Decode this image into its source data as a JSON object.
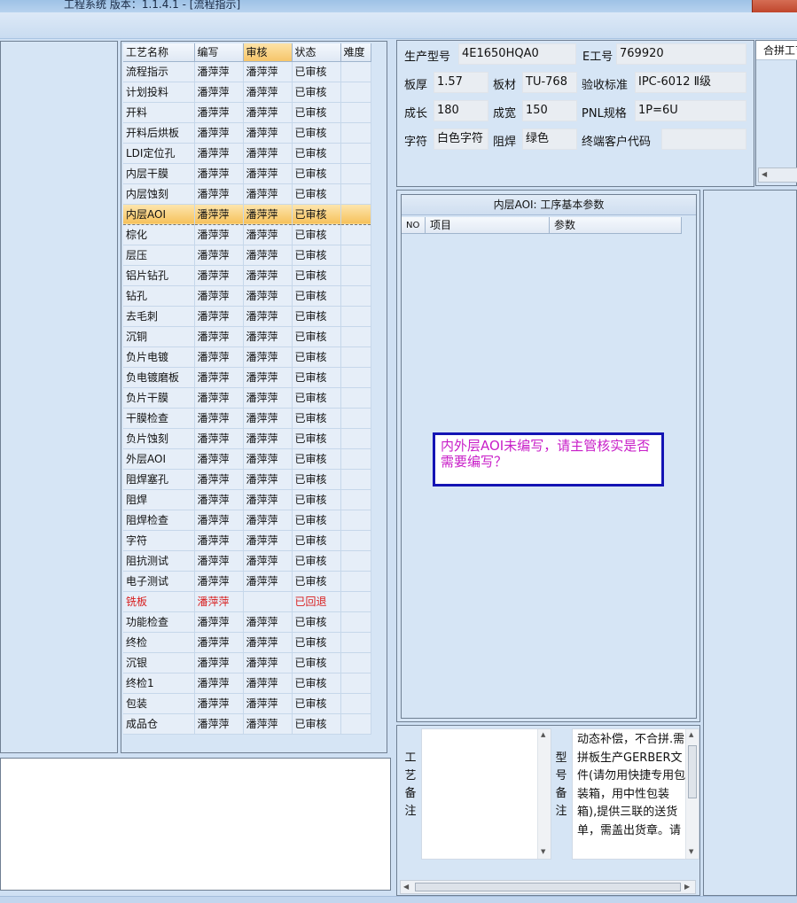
{
  "window": {
    "title": "工程系统   版本：1.1.4.1 - [流程指示]"
  },
  "grid": {
    "headers": [
      "工艺名称",
      "编写",
      "审核",
      "状态",
      "难度"
    ],
    "rows": [
      {
        "name": "流程指示",
        "writer": "潘萍萍",
        "reviewer": "潘萍萍",
        "status": "已审核",
        "difficulty": ""
      },
      {
        "name": "计划投料",
        "writer": "潘萍萍",
        "reviewer": "潘萍萍",
        "status": "已审核",
        "difficulty": ""
      },
      {
        "name": "开料",
        "writer": "潘萍萍",
        "reviewer": "潘萍萍",
        "status": "已审核",
        "difficulty": ""
      },
      {
        "name": "开料后烘板",
        "writer": "潘萍萍",
        "reviewer": "潘萍萍",
        "status": "已审核",
        "difficulty": ""
      },
      {
        "name": "LDI定位孔",
        "writer": "潘萍萍",
        "reviewer": "潘萍萍",
        "status": "已审核",
        "difficulty": ""
      },
      {
        "name": "内层干膜",
        "writer": "潘萍萍",
        "reviewer": "潘萍萍",
        "status": "已审核",
        "difficulty": ""
      },
      {
        "name": "内层蚀刻",
        "writer": "潘萍萍",
        "reviewer": "潘萍萍",
        "status": "已审核",
        "difficulty": ""
      },
      {
        "name": "内层AOI",
        "writer": "潘萍萍",
        "reviewer": "潘萍萍",
        "status": "已审核",
        "difficulty": ""
      },
      {
        "name": "棕化",
        "writer": "潘萍萍",
        "reviewer": "潘萍萍",
        "status": "已审核",
        "difficulty": ""
      },
      {
        "name": "层压",
        "writer": "潘萍萍",
        "reviewer": "潘萍萍",
        "status": "已审核",
        "difficulty": ""
      },
      {
        "name": "铝片钻孔",
        "writer": "潘萍萍",
        "reviewer": "潘萍萍",
        "status": "已审核",
        "difficulty": ""
      },
      {
        "name": "钻孔",
        "writer": "潘萍萍",
        "reviewer": "潘萍萍",
        "status": "已审核",
        "difficulty": ""
      },
      {
        "name": "去毛刺",
        "writer": "潘萍萍",
        "reviewer": "潘萍萍",
        "status": "已审核",
        "difficulty": ""
      },
      {
        "name": "沉铜",
        "writer": "潘萍萍",
        "reviewer": "潘萍萍",
        "status": "已审核",
        "difficulty": ""
      },
      {
        "name": "负片电镀",
        "writer": "潘萍萍",
        "reviewer": "潘萍萍",
        "status": "已审核",
        "difficulty": ""
      },
      {
        "name": "负电镀磨板",
        "writer": "潘萍萍",
        "reviewer": "潘萍萍",
        "status": "已审核",
        "difficulty": ""
      },
      {
        "name": "负片干膜",
        "writer": "潘萍萍",
        "reviewer": "潘萍萍",
        "status": "已审核",
        "difficulty": ""
      },
      {
        "name": "干膜检查",
        "writer": "潘萍萍",
        "reviewer": "潘萍萍",
        "status": "已审核",
        "difficulty": ""
      },
      {
        "name": "负片蚀刻",
        "writer": "潘萍萍",
        "reviewer": "潘萍萍",
        "status": "已审核",
        "difficulty": ""
      },
      {
        "name": "外层AOI",
        "writer": "潘萍萍",
        "reviewer": "潘萍萍",
        "status": "已审核",
        "difficulty": ""
      },
      {
        "name": "阻焊塞孔",
        "writer": "潘萍萍",
        "reviewer": "潘萍萍",
        "status": "已审核",
        "difficulty": ""
      },
      {
        "name": "阻焊",
        "writer": "潘萍萍",
        "reviewer": "潘萍萍",
        "status": "已审核",
        "difficulty": ""
      },
      {
        "name": "阻焊检查",
        "writer": "潘萍萍",
        "reviewer": "潘萍萍",
        "status": "已审核",
        "difficulty": ""
      },
      {
        "name": "字符",
        "writer": "潘萍萍",
        "reviewer": "潘萍萍",
        "status": "已审核",
        "difficulty": ""
      },
      {
        "name": "阻抗测试",
        "writer": "潘萍萍",
        "reviewer": "潘萍萍",
        "status": "已审核",
        "difficulty": ""
      },
      {
        "name": "电子测试",
        "writer": "潘萍萍",
        "reviewer": "潘萍萍",
        "status": "已审核",
        "difficulty": ""
      },
      {
        "name": "铣板",
        "writer": "潘萍萍",
        "reviewer": "",
        "status": "已回退",
        "difficulty": ""
      },
      {
        "name": "功能检查",
        "writer": "潘萍萍",
        "reviewer": "潘萍萍",
        "status": "已审核",
        "difficulty": ""
      },
      {
        "name": "终检",
        "writer": "潘萍萍",
        "reviewer": "潘萍萍",
        "status": "已审核",
        "difficulty": ""
      },
      {
        "name": "沉银",
        "writer": "潘萍萍",
        "reviewer": "潘萍萍",
        "status": "已审核",
        "difficulty": ""
      },
      {
        "name": "终检1",
        "writer": "潘萍萍",
        "reviewer": "潘萍萍",
        "status": "已审核",
        "difficulty": ""
      },
      {
        "name": "包装",
        "writer": "潘萍萍",
        "reviewer": "潘萍萍",
        "status": "已审核",
        "difficulty": ""
      },
      {
        "name": "成品仓",
        "writer": "潘萍萍",
        "reviewer": "潘萍萍",
        "status": "已审核",
        "difficulty": ""
      }
    ],
    "selected_row": "内层AOI",
    "rejected_status": "已回退"
  },
  "info": {
    "model_label": "生产型号",
    "model": "4E1650HQA0",
    "eno_label": "E工号",
    "eno": "769920",
    "thickness_label": "板厚",
    "thickness": "1.57",
    "material_label": "板材",
    "material": "TU-768",
    "standard_label": "验收标准",
    "standard": "IPC-6012 Ⅱ级",
    "length_label": "成长",
    "length": "180",
    "width_label": "成宽",
    "width": "150",
    "pnl_label": "PNL规格",
    "pnl": "1P=6U",
    "char_label": "字符",
    "char": "白色字符",
    "mask_label": "阻焊",
    "mask": "绿色",
    "customer_label": "终端客户代码",
    "customer": ""
  },
  "merge": {
    "title": "合拼工艺"
  },
  "params": {
    "title": "内层AOI: 工序基本参数",
    "col_no": "NO",
    "col_item": "项目",
    "col_param": "参数",
    "warning": "内外层AOI未编写，请主管核实是否需要编写？"
  },
  "notes": {
    "process_label": "工艺备注",
    "process_text": "",
    "model_label": "型号备注",
    "model_text": "动态补偿，不合拼.需拼板生产GERBER文件(请勿用快捷专用包装箱，用中性包装箱),提供三联的送货单，需盖出货章。请"
  },
  "colors": {
    "accent": "#f6c15a",
    "warning_text": "#c81ec8",
    "warning_border": "#1414b4",
    "rejected": "#d81e1e"
  }
}
